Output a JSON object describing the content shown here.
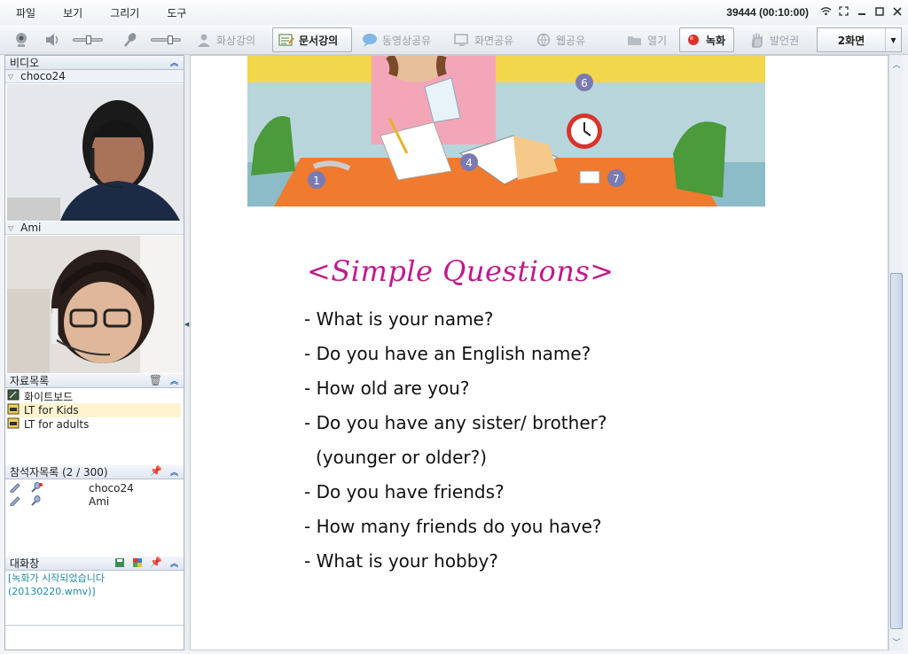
{
  "menu": [
    "파일",
    "보기",
    "그리기",
    "도구"
  ],
  "session": "39444 (00:10:00)",
  "toolbar": {
    "buttons": [
      {
        "label": "화상강의",
        "icon": "person-icon"
      },
      {
        "label": "문서강의",
        "icon": "document-icon"
      },
      {
        "label": "동영상공유",
        "icon": "video-chat-icon"
      },
      {
        "label": "화면공유",
        "icon": "screen-share-icon"
      },
      {
        "label": "웹공유",
        "icon": "web-icon"
      },
      {
        "label": "열기",
        "icon": "folder-icon"
      },
      {
        "label": "녹화",
        "icon": "record-icon"
      },
      {
        "label": "발언권",
        "icon": "hand-icon"
      }
    ],
    "split_label": "2화면"
  },
  "left": {
    "video_header": "비디오",
    "videos": [
      {
        "name": "choco24"
      },
      {
        "name": "Ami"
      }
    ],
    "files_header": "자료목록",
    "files": [
      "화이트보드",
      "LT for Kids",
      "LT for adults"
    ],
    "participants_header": "참석자목록 (2 / 300)",
    "participants": [
      "choco24",
      "Ami"
    ],
    "chat_header": "대화창",
    "chat_messages": [
      "[녹화가 시작되었습니다",
      "(20130220.wmv)]"
    ]
  },
  "document": {
    "title": "<Simple Questions>",
    "callouts": [
      "6",
      "4",
      "1",
      "7"
    ],
    "lines": [
      "- What is your name?",
      "- Do you have an English name?",
      "- How old are you?",
      "- Do you have any sister/ brother?",
      "(younger or older?)",
      "- Do you have friends?",
      "- How many friends do you have?",
      "- What is your hobby?"
    ]
  },
  "colors": {
    "accent": "#3968b5",
    "title": "#c01a8a",
    "chat_text": "#1f8ba3",
    "record": "#d9332b"
  }
}
